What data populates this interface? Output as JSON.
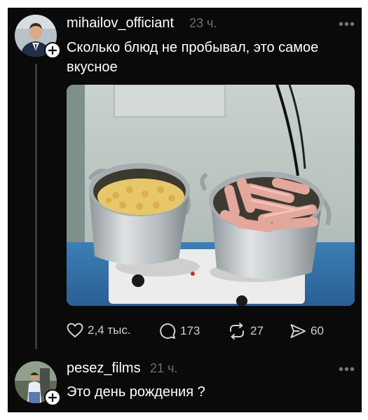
{
  "posts": [
    {
      "username": "mihailov_officiant",
      "time": "23 ч.",
      "text": "Сколько блюд не пробывал, это самое вкусное",
      "image": "photo of two aluminum pots on an electric stove: pasta and sausages",
      "actions": {
        "like_count": "2,4 тыс.",
        "comment_count": "173",
        "repost_count": "27",
        "share_count": "60"
      }
    },
    {
      "username": "pesez_films",
      "time": "21 ч.",
      "text": "Это день рождения ?"
    }
  ],
  "icons": {
    "more": "more-horizontal-icon",
    "like": "heart-icon",
    "comment": "comment-bubble-icon",
    "repost": "repost-arrows-icon",
    "share": "send-icon",
    "follow": "plus-icon"
  },
  "colors": {
    "background": "#0a0a0a",
    "text": "#ffffff",
    "muted": "#6e6e6e",
    "thread_line": "#3a3a3a"
  }
}
